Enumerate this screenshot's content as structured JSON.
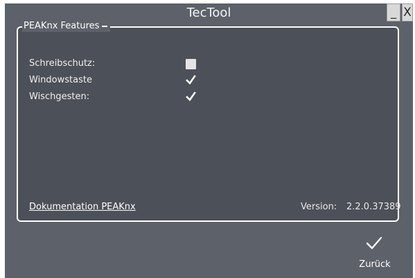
{
  "window": {
    "title": "TecTool",
    "minimize_label": "_",
    "close_label": "X"
  },
  "group": {
    "legend": "PEAKnx Features",
    "options": [
      {
        "label": "Schreibschutz:",
        "checked": false
      },
      {
        "label": "Windowstaste",
        "checked": true
      },
      {
        "label": "Wischgesten:",
        "checked": true
      }
    ]
  },
  "footer": {
    "doc_link": "Dokumentation PEAKnx",
    "version_label": "Version:",
    "version_value": "2.2.0.37389"
  },
  "actions": {
    "back_label": "Zurück",
    "back_icon": "checkmark-icon"
  },
  "colors": {
    "window_bg": "#5d6169",
    "panel_bg": "#4c5058",
    "border": "#ffffff"
  }
}
